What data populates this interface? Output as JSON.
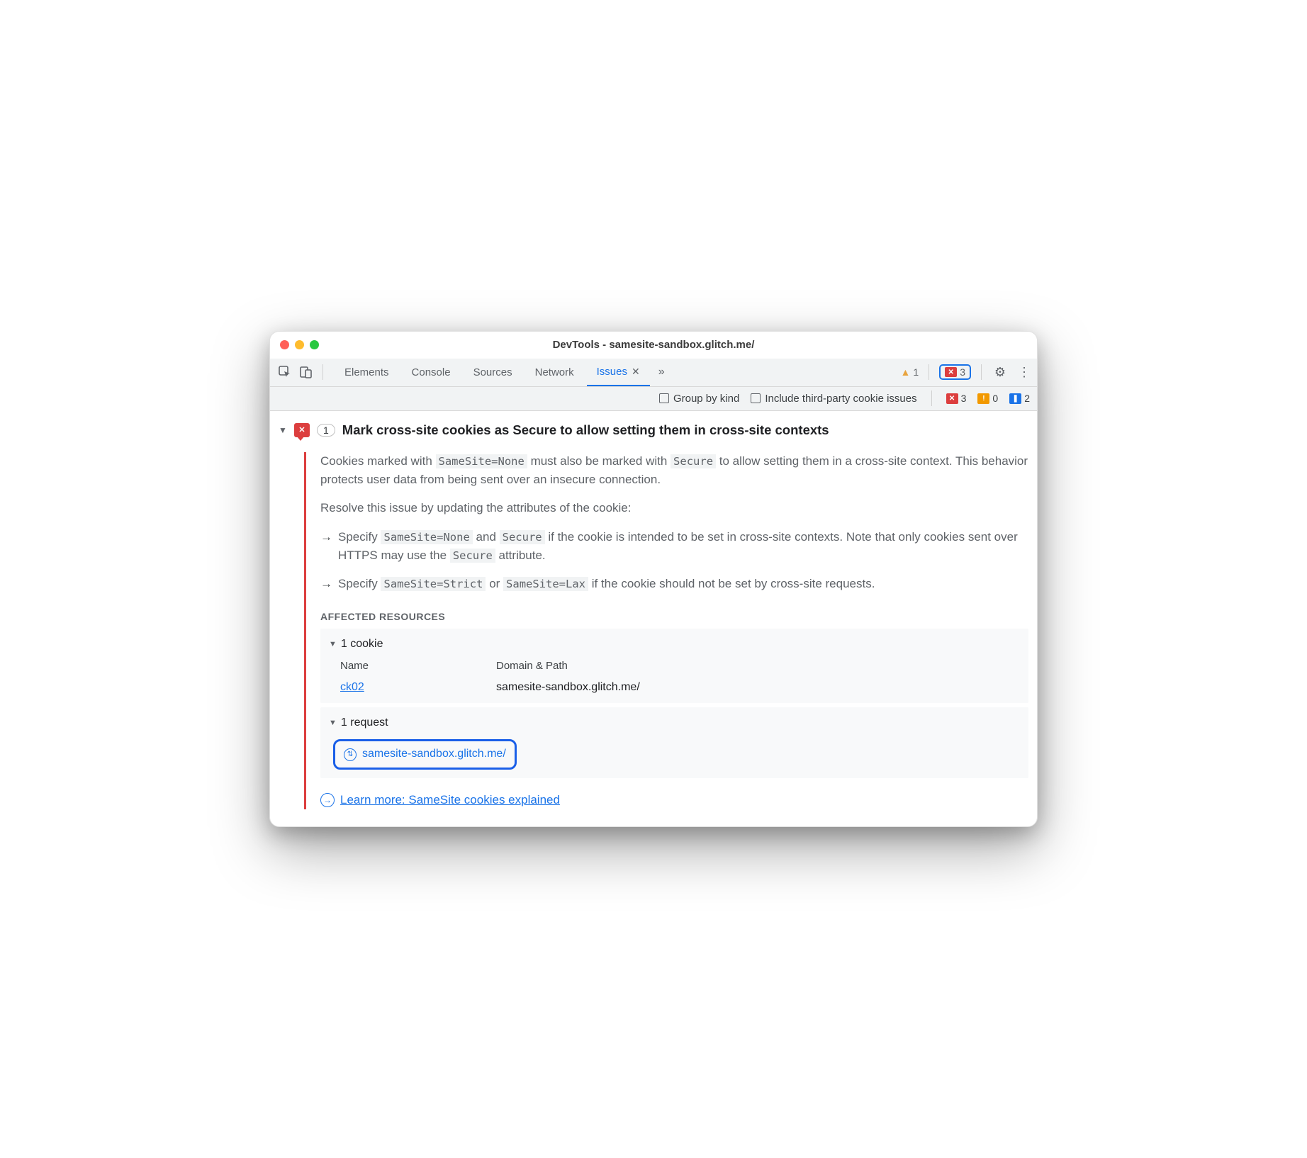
{
  "window": {
    "title": "DevTools - samesite-sandbox.glitch.me/"
  },
  "tabs": {
    "elements": "Elements",
    "console": "Console",
    "sources": "Sources",
    "network": "Network",
    "issues": "Issues"
  },
  "top_badges": {
    "warn_count": "1",
    "err_count": "3"
  },
  "options": {
    "group_by_kind": "Group by kind",
    "include_third_party": "Include third-party cookie issues"
  },
  "stat_counts": {
    "err": "3",
    "warn": "0",
    "msg": "2"
  },
  "issue": {
    "count": "1",
    "title": "Mark cross-site cookies as Secure to allow setting them in cross-site contexts",
    "desc_p1a": "Cookies marked with ",
    "desc_p1_code1": "SameSite=None",
    "desc_p1b": " must also be marked with ",
    "desc_p1_code2": "Secure",
    "desc_p1c": " to allow setting them in a cross-site context. This behavior protects user data from being sent over an insecure connection.",
    "desc_p2": "Resolve this issue by updating the attributes of the cookie:",
    "bullet1_a": "Specify ",
    "bullet1_c1": "SameSite=None",
    "bullet1_b": " and ",
    "bullet1_c2": "Secure",
    "bullet1_c": " if the cookie is intended to be set in cross-site contexts. Note that only cookies sent over HTTPS may use the ",
    "bullet1_c3": "Secure",
    "bullet1_d": " attribute.",
    "bullet2_a": "Specify ",
    "bullet2_c1": "SameSite=Strict",
    "bullet2_b": " or ",
    "bullet2_c2": "SameSite=Lax",
    "bullet2_c": " if the cookie should not be set by cross-site requests.",
    "affected_label": "AFFECTED RESOURCES",
    "cookie_hdr": "1 cookie",
    "cookie_cols": {
      "name": "Name",
      "domain": "Domain & Path"
    },
    "cookie_row": {
      "name": "ck02",
      "domain": "samesite-sandbox.glitch.me/"
    },
    "request_hdr": "1 request",
    "request_url": "samesite-sandbox.glitch.me/",
    "learn_more": "Learn more: SameSite cookies explained"
  }
}
